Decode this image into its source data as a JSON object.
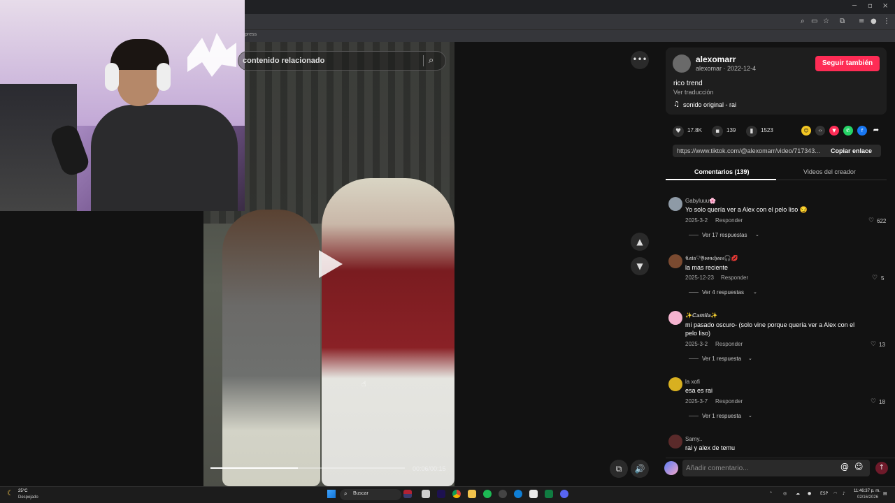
{
  "browser": {
    "bookmark_fragment": "press",
    "window_minimize": "─",
    "window_maximize": "▫",
    "window_close": "×"
  },
  "video": {
    "search_text": "contenido relacionado",
    "time": "00:06/00:15",
    "progress": 0.45
  },
  "author": {
    "name": "alexomarr",
    "sub": "alexomar · 2022-12-4",
    "follow_label": "Seguir también",
    "caption": "rico trend",
    "translate": "Ver traducción",
    "music": "sonido original - rai"
  },
  "stats": {
    "likes": "17.8K",
    "comments": "139",
    "saves": "1523"
  },
  "link": {
    "url": "https://www.tiktok.com/@alexomarr/video/717343...",
    "copy_label": "Copiar enlace"
  },
  "tabs": {
    "comments": "Comentarios (139)",
    "videos": "Videos del creador"
  },
  "comments": [
    {
      "user": "Gabyluuu🌸",
      "text": "Yo solo quería ver a Alex con el pelo liso 😏",
      "date": "2025-3-2",
      "reply": "Responder",
      "likes": "622",
      "more": "Ver 17 respuestas",
      "avatar_color": "#8e9aa6"
    },
    {
      "user": "𝕮𝖆𝖙𝖆♡𝖄𝖔𝖔𝖓𝖈𝖍𝖆𝖊𝖘🎧💋",
      "text": "la mas reciente",
      "date": "2025-12-23",
      "reply": "Responder",
      "likes": "5",
      "more": "Ver 4 respuestas",
      "avatar_color": "#7a4a30"
    },
    {
      "user": "✨𝑪𝒂𝒎𝒊𝒍𝒂✨",
      "text": "mi pasado oscuro- (solo vine porque quería ver a Alex con el pelo liso)",
      "date": "2025-3-2",
      "reply": "Responder",
      "likes": "13",
      "more": "Ver 1 respuesta",
      "avatar_color": "#f4b3cf"
    },
    {
      "user": "la xofi",
      "text": "esa es rai",
      "date": "2025-3-7",
      "reply": "Responder",
      "likes": "18",
      "more": "Ver 1 respuesta",
      "avatar_color": "#d8b020"
    },
    {
      "user": "Samy..",
      "text": "rai y alex de temu",
      "avatar_color": "#5a2a2a"
    }
  ],
  "comment_input": {
    "placeholder": "Añadir comentario..."
  },
  "taskbar": {
    "temp": "25°C",
    "weather": "Despejado",
    "search": "Buscar",
    "lang": "ESP",
    "time": "11:46:37 p. m.",
    "date": "02/16/2026"
  }
}
